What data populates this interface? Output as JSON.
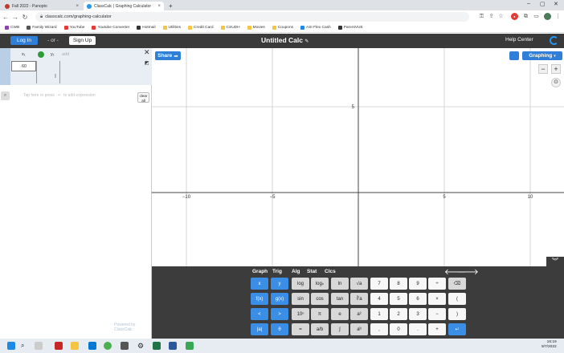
{
  "browser": {
    "tabs": [
      {
        "title": "Fall 2022 - Panopto",
        "color": "#c0392b"
      },
      {
        "title": "ClassCalc | Graphing Calculator",
        "color": "#2196f3"
      }
    ],
    "new_tab": "+",
    "url": "classcalc.com/graphing-calculator",
    "bookmarks": [
      {
        "label": "CWB",
        "color": "#8e44ad"
      },
      {
        "label": "Family Wizard",
        "color": "#555"
      },
      {
        "label": "YouTube",
        "color": "#e53935"
      },
      {
        "label": "Youtube Converter",
        "color": "#e53935"
      },
      {
        "label": "Hotmail",
        "color": "#333"
      },
      {
        "label": "Utilities",
        "color": "#f4c542"
      },
      {
        "label": "Credit Card",
        "color": "#f4c542"
      },
      {
        "label": "CSUDH",
        "color": "#f4c542"
      },
      {
        "label": "Movies",
        "color": "#f4c542"
      },
      {
        "label": "Coupons",
        "color": "#f4c542"
      },
      {
        "label": "ASI Flex Cash",
        "color": "#1e88e5"
      },
      {
        "label": "ParentVUE",
        "color": "#333"
      }
    ]
  },
  "header": {
    "login": "Log In",
    "or": "- or -",
    "signup": "Sign Up",
    "title": "Untitled Calc",
    "help": "Help Center"
  },
  "table": {
    "col_x": "x₁",
    "col_y": "y₁",
    "add": "add",
    "row1_x": "60"
  },
  "search": {
    "placeholder": "Tap here or press",
    "placeholder2": "to add expression",
    "clear": "clear all"
  },
  "watermark": "Powered by ClassCalc",
  "graph": {
    "share": "Share",
    "mode": "Graphing",
    "zoom_out": "−",
    "zoom_in": "+",
    "xlabels": [
      "−10",
      "−5",
      "5",
      "10"
    ],
    "ylabels": [
      "5"
    ]
  },
  "keypad": {
    "tabs": [
      "Graph",
      "Trig",
      "Alg",
      "Stat",
      "Clcs"
    ],
    "rows": [
      [
        [
          "x",
          "blue"
        ],
        [
          "y",
          "blue"
        ],
        [
          "log",
          "gray"
        ],
        [
          "logₙ",
          "gray"
        ],
        [
          "ln",
          "gray"
        ],
        [
          "√a",
          "gray"
        ],
        [
          "7",
          "white"
        ],
        [
          "8",
          "white"
        ],
        [
          "9",
          "white"
        ],
        [
          "÷",
          "white"
        ],
        [
          "⌫",
          "gray"
        ]
      ],
      [
        [
          "f(x)",
          "blue"
        ],
        [
          "g(x)",
          "blue"
        ],
        [
          "sin",
          "gray"
        ],
        [
          "cos",
          "gray"
        ],
        [
          "tan",
          "gray"
        ],
        [
          "∛a",
          "gray"
        ],
        [
          "4",
          "white"
        ],
        [
          "5",
          "white"
        ],
        [
          "6",
          "white"
        ],
        [
          "×",
          "white"
        ],
        [
          "(",
          "white"
        ]
      ],
      [
        [
          "<",
          "blue"
        ],
        [
          ">",
          "blue"
        ],
        [
          "10ⁿ",
          "gray"
        ],
        [
          "π",
          "gray"
        ],
        [
          "e",
          "gray"
        ],
        [
          "a²",
          "gray"
        ],
        [
          "1",
          "white"
        ],
        [
          "2",
          "white"
        ],
        [
          "3",
          "white"
        ],
        [
          "−",
          "white"
        ],
        [
          ")",
          "white"
        ]
      ],
      [
        [
          "|a|",
          "blue"
        ],
        [
          "θ",
          "blue"
        ],
        [
          "=",
          "gray"
        ],
        [
          "a/b",
          "gray"
        ],
        [
          "∫",
          "gray"
        ],
        [
          "aᵇ",
          "gray"
        ],
        [
          ",",
          "white"
        ],
        [
          "0",
          "white"
        ],
        [
          ".",
          "white"
        ],
        [
          "+",
          "white"
        ],
        [
          "↵",
          "blue"
        ]
      ]
    ]
  },
  "taskbar": {
    "time": "16:19",
    "date": "9/7/2022"
  }
}
